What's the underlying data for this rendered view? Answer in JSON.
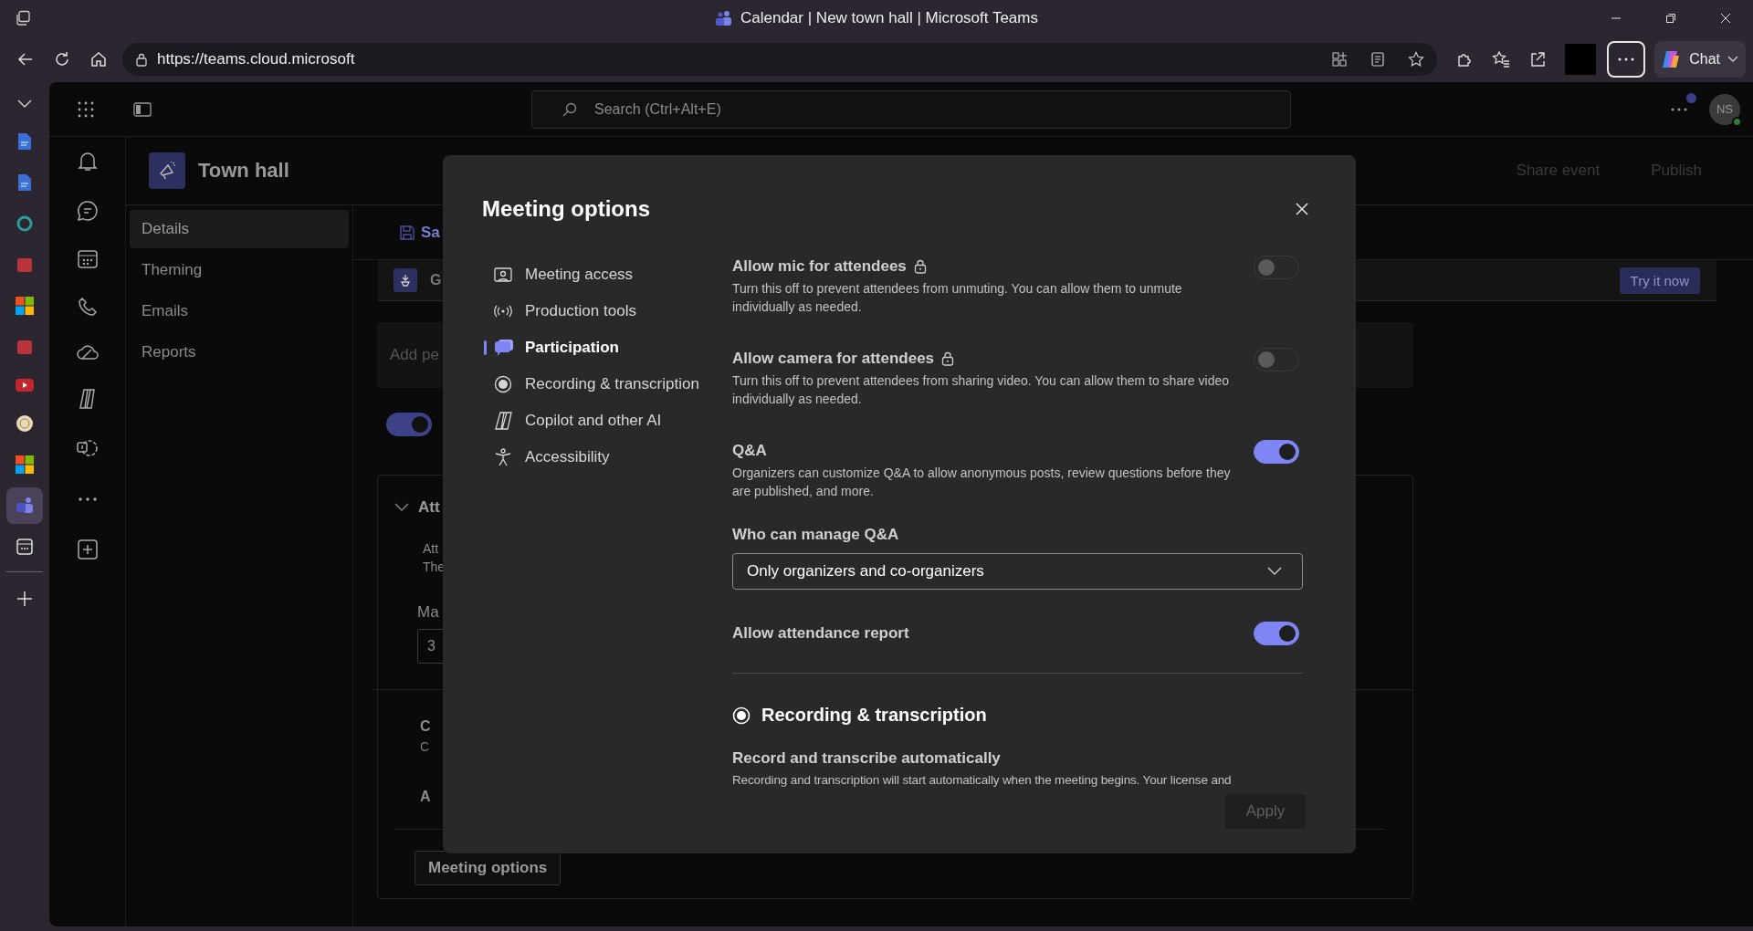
{
  "browser": {
    "title": "Calendar | New town hall | Microsoft Teams",
    "url": "https://teams.cloud.microsoft",
    "chat_button": "Chat"
  },
  "teams": {
    "search_placeholder": "Search (Ctrl+Alt+E)",
    "avatar": "NS",
    "event_title": "Town hall",
    "header_actions": [
      "Share event",
      "Publish"
    ],
    "nav": [
      {
        "label": "Details",
        "selected": true
      },
      {
        "label": "Theming",
        "selected": false
      },
      {
        "label": "Emails",
        "selected": false
      },
      {
        "label": "Reports",
        "selected": false
      }
    ]
  },
  "content": {
    "save": "Sa",
    "banner": "G",
    "try_button": "Try it now",
    "add_field": "Add pe",
    "toggle_on": true,
    "section_title": "Att",
    "section_lines": [
      "Att",
      "The"
    ],
    "field_label": "Ma",
    "field_value": "3",
    "row_title": "C",
    "row_text": "C",
    "row_last": "A",
    "options_button": "Meeting options"
  },
  "dialog": {
    "title": "Meeting options",
    "nav": [
      {
        "label": "Meeting access",
        "selected": false
      },
      {
        "label": "Production tools",
        "selected": false
      },
      {
        "label": "Participation",
        "selected": true
      },
      {
        "label": "Recording & transcription",
        "selected": false
      },
      {
        "label": "Copilot and other AI",
        "selected": false
      },
      {
        "label": "Accessibility",
        "selected": false
      }
    ],
    "settings": [
      {
        "kind": "toggle",
        "title": "Allow mic for attendees",
        "locked": true,
        "description": "Turn this off to prevent attendees from unmuting. You can allow them to unmute individually as needed.",
        "on": false
      },
      {
        "kind": "toggle",
        "title": "Allow camera for attendees",
        "locked": true,
        "description": "Turn this off to prevent attendees from sharing video. You can allow them to share video individually as needed.",
        "on": false
      },
      {
        "kind": "toggle",
        "title": "Q&A",
        "locked": false,
        "description": "Organizers can customize Q&A to allow anonymous posts, review questions before they are published, and more.",
        "on": true
      },
      {
        "kind": "dropdown",
        "label": "Who can manage Q&A",
        "value": "Only organizers and co-organizers"
      },
      {
        "kind": "toggle",
        "title": "Allow attendance report",
        "locked": false,
        "on": true
      },
      {
        "kind": "divider"
      },
      {
        "kind": "section",
        "title": "Recording & transcription"
      },
      {
        "kind": "info",
        "title": "Record and transcribe automatically",
        "description": "Recording and transcription will start automatically when the meeting begins. Your license and"
      }
    ],
    "apply": "Apply"
  }
}
